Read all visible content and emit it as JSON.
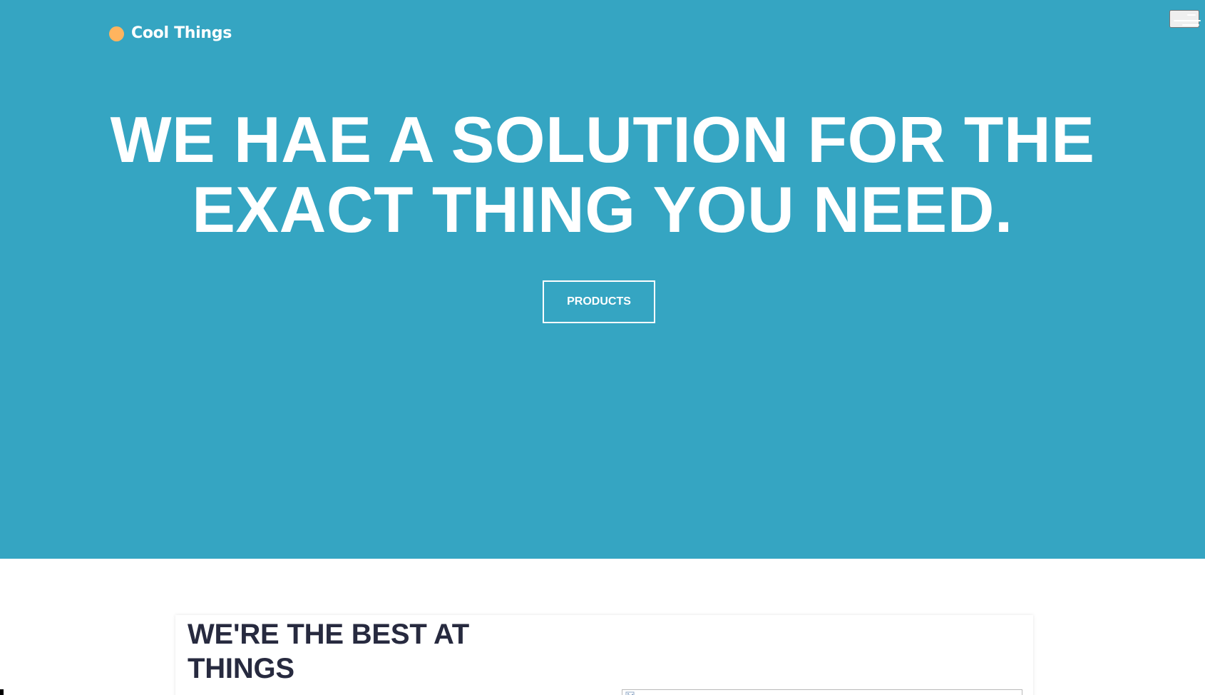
{
  "brand": {
    "name": "Cool Things",
    "dot_color": "#ffb45e"
  },
  "header": {
    "menu_icon": "hamburger-menu-icon"
  },
  "hero": {
    "headline": "WE HAE A SOLUTION FOR THE EXACT THING YOU NEED.",
    "button_label": "PRODUCTS",
    "background_color": "#35a5c2",
    "text_color": "#ffffff"
  },
  "features": {
    "title": "WE'RE THE BEST AT THINGS",
    "title_color": "#272a3f",
    "image_icon": "broken-image-icon"
  }
}
